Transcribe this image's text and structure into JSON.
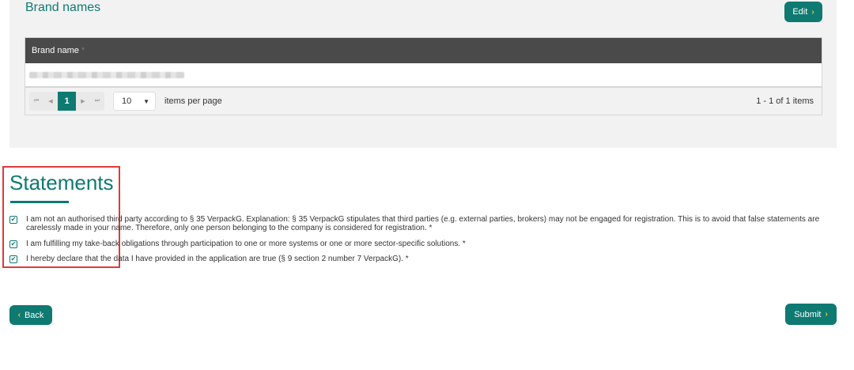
{
  "brand": {
    "title": "Brand names",
    "edit_label": "Edit",
    "column_header": "Brand name",
    "column_required_mark": "*",
    "pager": {
      "first": "⏮",
      "prev": "◀",
      "current_page": "1",
      "next": "▶",
      "last": "⏭",
      "per_page_value": "10",
      "per_page_label": "items per page",
      "info": "1 - 1 of 1 items"
    }
  },
  "statements": {
    "title": "Statements",
    "items": [
      {
        "text": "I am not an authorised third party according to § 35 VerpackG. Explanation: § 35 VerpackG stipulates that third parties (e.g. external parties, brokers) may not be engaged for registration. This is to avoid that false statements are carelessly made in your name. Therefore, only one person belonging to the company is considered for registration. *",
        "checked": true
      },
      {
        "text": "I am fulfilling my take-back obligations through participation to one or more systems or one or more sector-specific solutions. *",
        "checked": true
      },
      {
        "text": "I hereby declare that the data I have provided in the application are true (§ 9 section 2 number 7 VerpackG). *",
        "checked": true
      }
    ]
  },
  "nav": {
    "back_label": "Back",
    "submit_label": "Submit"
  },
  "icons": {
    "chevron_left": "‹",
    "chevron_right": "›",
    "check": "✔",
    "dropdown": "▼"
  },
  "colors": {
    "accent": "#0e7a72",
    "chevron": "#f5c518",
    "header_bg": "#4a4a4a",
    "highlight": "#e03a3a"
  }
}
